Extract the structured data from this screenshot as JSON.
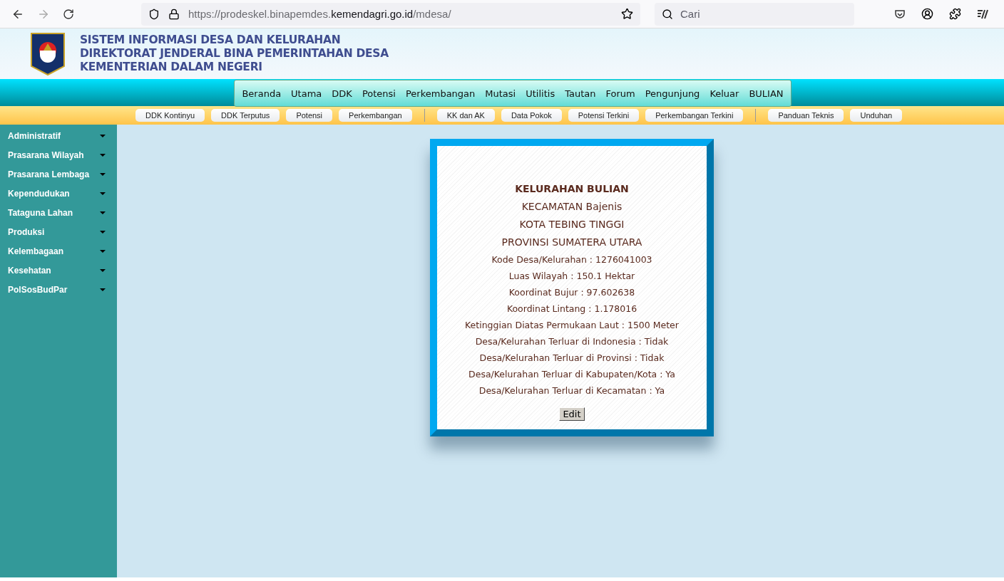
{
  "browser": {
    "url": "https://prodeskel.binapemdes.**kemendagri.go.id**/mdesa/",
    "search": {
      "placeholder": "Cari"
    }
  },
  "header": {
    "lines": [
      "SISTEM INFORMASI DESA DAN KELURAHAN",
      "DIREKTORAT JENDERAL BINA PEMERINTAHAN DESA",
      "KEMENTERIAN DALAM NEGERI"
    ]
  },
  "main_nav": [
    "Beranda",
    "Utama",
    "DDK",
    "Potensi",
    "Perkembangan",
    "Mutasi",
    "Utilitis",
    "Tautan",
    "Forum",
    "Pengunjung",
    "Keluar",
    "BULIAN"
  ],
  "sub_nav": [
    [
      "DDK Kontinyu",
      "DDK Terputus",
      "Potensi",
      "Perkembangan"
    ],
    [
      "KK dan AK",
      "Data Pokok",
      "Potensi Terkini",
      "Perkembangan Terkini"
    ],
    [
      "Panduan Teknis",
      "Unduhan"
    ]
  ],
  "sidebar": {
    "items": [
      "Administratif",
      "Prasarana Wilayah",
      "Prasarana Lembaga",
      "Kependudukan",
      "Tataguna Lahan",
      "Produksi",
      "Kelembagaan",
      "Kesehatan",
      "PolSosBudPar"
    ]
  },
  "card": {
    "title": "KELURAHAN BULIAN",
    "subtitles": [
      "KECAMATAN Bajenis",
      "KOTA TEBING TINGGI",
      "PROVINSI SUMATERA UTARA"
    ],
    "details": [
      "Kode Desa/Kelurahan : 1276041003",
      "Luas Wilayah : 150.1 Hektar",
      "Koordinat Bujur : 97.602638",
      "Koordinat Lintang : 1.178016",
      "Ketinggian Diatas Permukaan Laut : 1500 Meter",
      "Desa/Kelurahan Terluar di Indonesia : Tidak",
      "Desa/Kelurahan Terluar di Provinsi : Tidak",
      "Desa/Kelurahan Terluar di Kabupaten/Kota : Ya",
      "Desa/Kelurahan Terluar di Kecamatan : Ya"
    ],
    "button": "Edit"
  }
}
